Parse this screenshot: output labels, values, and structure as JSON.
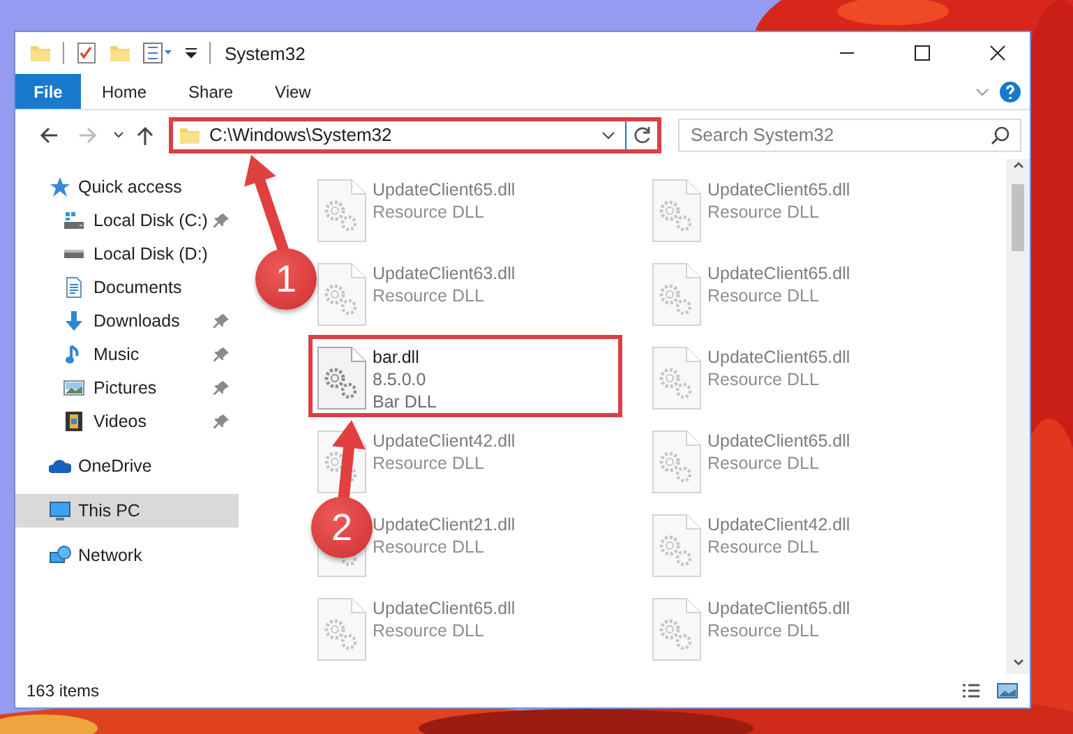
{
  "window": {
    "title": "System32"
  },
  "ribbon": {
    "tabs": [
      {
        "label": "File",
        "kind": "file"
      },
      {
        "label": "Home",
        "kind": "plain"
      },
      {
        "label": "Share",
        "kind": "plain"
      },
      {
        "label": "View",
        "kind": "plain"
      }
    ]
  },
  "address": {
    "path": "C:\\Windows\\System32",
    "highlighted": true
  },
  "search": {
    "placeholder": "Search System32"
  },
  "nav": [
    {
      "label": "Quick access",
      "kind": "star",
      "selected": false,
      "children": [
        {
          "label": "Local Disk (C:)",
          "kind": "system-drive",
          "pinned": true,
          "selected": false
        },
        {
          "label": "Local Disk (D:)",
          "kind": "drive",
          "pinned": false,
          "selected": false
        },
        {
          "label": "Documents",
          "kind": "documents",
          "pinned": false,
          "selected": false
        },
        {
          "label": "Downloads",
          "kind": "downloads",
          "pinned": true,
          "selected": false
        },
        {
          "label": "Music",
          "kind": "music",
          "pinned": true,
          "selected": false
        },
        {
          "label": "Pictures",
          "kind": "pictures",
          "pinned": true,
          "selected": false
        },
        {
          "label": "Videos",
          "kind": "videos",
          "pinned": true,
          "selected": false
        }
      ]
    },
    {
      "label": "OneDrive",
      "kind": "cloud",
      "selected": false
    },
    {
      "label": "This PC",
      "kind": "pc",
      "selected": true
    },
    {
      "label": "Network",
      "kind": "network",
      "selected": false
    }
  ],
  "files": [
    {
      "name": "UpdateClient65.dll",
      "lines": [
        "Resource DLL"
      ],
      "dimmed": true,
      "highlighted": false
    },
    {
      "name": "UpdateClient65.dll",
      "lines": [
        "Resource DLL"
      ],
      "dimmed": true,
      "highlighted": false
    },
    {
      "name": "UpdateClient63.dll",
      "lines": [
        "Resource DLL"
      ],
      "dimmed": true,
      "highlighted": false
    },
    {
      "name": "UpdateClient65.dll",
      "lines": [
        "Resource DLL"
      ],
      "dimmed": true,
      "highlighted": false
    },
    {
      "name": "bar.dll",
      "lines": [
        "8.5.0.0",
        "Bar DLL"
      ],
      "dimmed": false,
      "highlighted": true
    },
    {
      "name": "UpdateClient65.dll",
      "lines": [
        "Resource DLL"
      ],
      "dimmed": true,
      "highlighted": false
    },
    {
      "name": "UpdateClient42.dll",
      "lines": [
        "Resource DLL"
      ],
      "dimmed": true,
      "highlighted": false
    },
    {
      "name": "UpdateClient65.dll",
      "lines": [
        "Resource DLL"
      ],
      "dimmed": true,
      "highlighted": false
    },
    {
      "name": "UpdateClient21.dll",
      "lines": [
        "Resource DLL"
      ],
      "dimmed": true,
      "highlighted": false
    },
    {
      "name": "UpdateClient42.dll",
      "lines": [
        "Resource DLL"
      ],
      "dimmed": true,
      "highlighted": false
    },
    {
      "name": "UpdateClient65.dll",
      "lines": [
        "Resource DLL"
      ],
      "dimmed": true,
      "highlighted": false
    },
    {
      "name": "UpdateClient65.dll",
      "lines": [
        "Resource DLL"
      ],
      "dimmed": true,
      "highlighted": false
    }
  ],
  "annotations": [
    {
      "label": "1"
    },
    {
      "label": "2"
    }
  ],
  "status": {
    "count": "163 items"
  }
}
